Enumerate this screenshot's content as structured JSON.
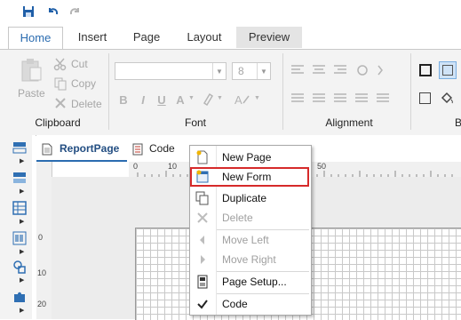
{
  "quick_access": {
    "save_icon": "save-icon",
    "undo_icon": "undo-icon",
    "redo_icon": "redo-icon"
  },
  "tabs": [
    {
      "label": "Home"
    },
    {
      "label": "Insert"
    },
    {
      "label": "Page"
    },
    {
      "label": "Layout"
    },
    {
      "label": "Preview"
    }
  ],
  "ribbon": {
    "clipboard": {
      "paste": "Paste",
      "cut": "Cut",
      "copy": "Copy",
      "delete": "Delete",
      "label": "Clipboard"
    },
    "font": {
      "font_size": "8",
      "bold": "B",
      "italic": "I",
      "underline": "U",
      "font_color": "A",
      "label": "Font"
    },
    "alignment": {
      "label": "Alignment"
    },
    "borders": {
      "label_fragment": "B"
    }
  },
  "doc_tabs": {
    "report_page": "ReportPage",
    "code": "Code"
  },
  "ruler": {
    "h_ticks": [
      "0",
      "10",
      "50"
    ],
    "v_ticks": [
      "0",
      "10",
      "20"
    ]
  },
  "context_menu": {
    "items": [
      {
        "label": "New Page",
        "icon": "new-page-icon",
        "enabled": true
      },
      {
        "label": "New Form",
        "icon": "new-form-icon",
        "enabled": true,
        "highlighted": true
      },
      {
        "label": "Duplicate",
        "icon": "duplicate-icon",
        "enabled": true
      },
      {
        "label": "Delete",
        "icon": "delete-icon",
        "enabled": false
      },
      {
        "label": "Move Left",
        "icon": "move-left-icon",
        "enabled": false
      },
      {
        "label": "Move Right",
        "icon": "move-right-icon",
        "enabled": false
      },
      {
        "label": "Page Setup...",
        "icon": "page-setup-icon",
        "enabled": true
      },
      {
        "label": "Code",
        "icon": "checkmark-icon",
        "enabled": true
      }
    ]
  },
  "colors": {
    "accent": "#2b6cb0",
    "highlight_border": "#d62a2a"
  }
}
